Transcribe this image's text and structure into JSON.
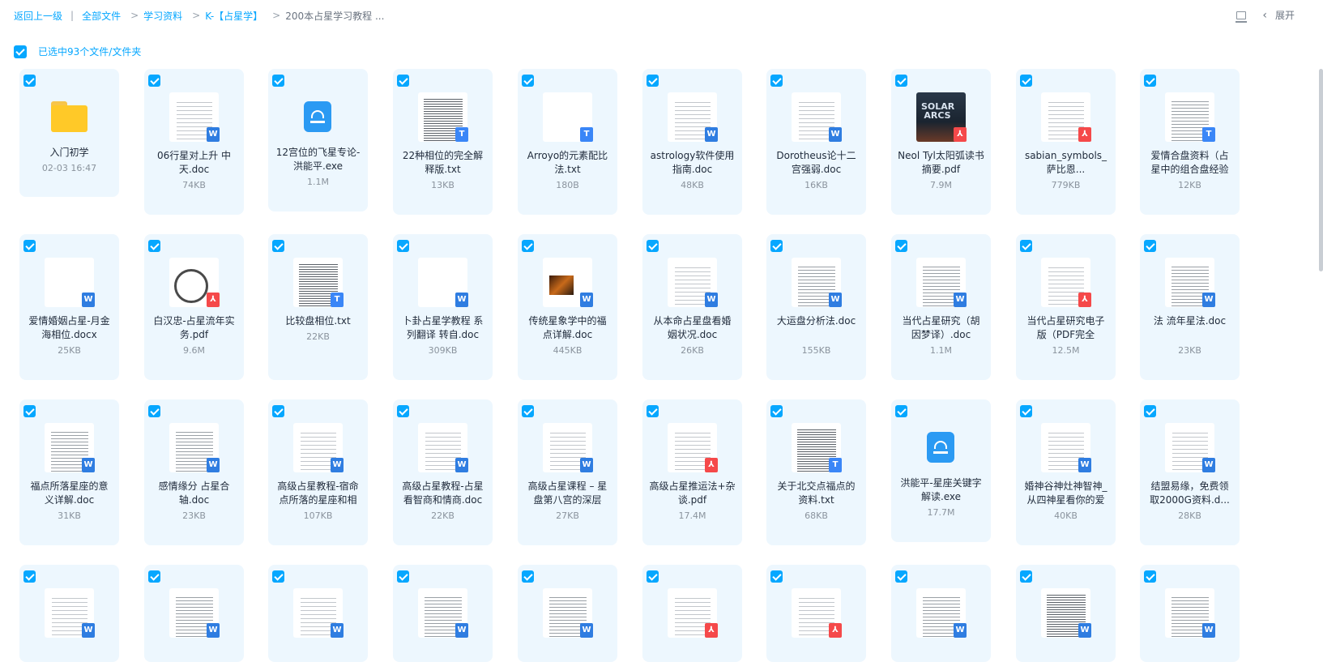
{
  "breadcrumb": {
    "back": "返回上一级",
    "all_files": "全部文件",
    "study": "学习资料",
    "astro": "K-【占星学】",
    "current": "200本占星学习教程 ..."
  },
  "topright": {
    "expand": "展开"
  },
  "selection": {
    "text": "已选中93个文件/文件夹"
  },
  "colors": {
    "accent": "#06a7ff",
    "card_bg": "#edf7fe",
    "doc_badge": "#2f7de1",
    "pdf_badge": "#f5494a"
  },
  "files": [
    {
      "name": "入门初学",
      "meta": "02-03 16:47",
      "kind": "folder",
      "thumb": "folder"
    },
    {
      "name": "06行星对上升 中天.doc",
      "meta": "74KB",
      "kind": "doc",
      "thumb": "light"
    },
    {
      "name": "12宫位的飞星专论-洪能平.exe",
      "meta": "1.1M",
      "kind": "exe",
      "thumb": "exe"
    },
    {
      "name": "22种相位的完全解释版.txt",
      "meta": "13KB",
      "kind": "txt",
      "thumb": "dense"
    },
    {
      "name": "Arroyo的元素配比法.txt",
      "meta": "180B",
      "kind": "txt",
      "thumb": "blank"
    },
    {
      "name": "astrology软件使用指南.doc",
      "meta": "48KB",
      "kind": "doc",
      "thumb": "light"
    },
    {
      "name": "Dorotheus论十二宫强弱.doc",
      "meta": "16KB",
      "kind": "doc",
      "thumb": "light"
    },
    {
      "name": "Neol Tyl太阳弧读书摘要.pdf",
      "meta": "7.9M",
      "kind": "pdf",
      "thumb": "book",
      "cover": "SOLAR ARCS"
    },
    {
      "name": "sabian_symbols_萨比恩...",
      "meta": "779KB",
      "kind": "pdf",
      "thumb": "light"
    },
    {
      "name": "爱情合盘资料（占星中的组合盘经验",
      "meta": "12KB",
      "kind": "txt",
      "thumb": "lined"
    },
    {
      "name": "爱情婚姻占星-月金海相位.docx",
      "meta": "25KB",
      "kind": "doc",
      "thumb": "blank"
    },
    {
      "name": "白汉忠-占星流年实务.pdf",
      "meta": "9.6M",
      "kind": "pdf",
      "thumb": "wheel"
    },
    {
      "name": "比较盘相位.txt",
      "meta": "22KB",
      "kind": "txt",
      "thumb": "dense"
    },
    {
      "name": "卜卦占星学教程 系列翻译 转自.doc",
      "meta": "309KB",
      "kind": "doc",
      "thumb": "blank"
    },
    {
      "name": "传统星象学中的福点详解.doc",
      "meta": "445KB",
      "kind": "doc",
      "thumb": "photo"
    },
    {
      "name": "从本命占星盘看婚姻状况.doc",
      "meta": "26KB",
      "kind": "doc",
      "thumb": "light"
    },
    {
      "name": "大运盘分析法.doc",
      "meta": "155KB",
      "kind": "doc",
      "thumb": "lined"
    },
    {
      "name": "当代占星研究（胡因梦译）.doc",
      "meta": "1.1M",
      "kind": "doc",
      "thumb": "lined"
    },
    {
      "name": "当代占星研究电子版（PDF完全",
      "meta": "12.5M",
      "kind": "pdf",
      "thumb": "light"
    },
    {
      "name": "法 流年星法.doc",
      "meta": "23KB",
      "kind": "doc",
      "thumb": "lined"
    },
    {
      "name": "福点所落星座的意义详解.doc",
      "meta": "31KB",
      "kind": "doc",
      "thumb": "lined"
    },
    {
      "name": "感情缘分 占星合轴.doc",
      "meta": "23KB",
      "kind": "doc",
      "thumb": "lined"
    },
    {
      "name": "高级占星教程-宿命点所落的星座和相",
      "meta": "107KB",
      "kind": "doc",
      "thumb": "light"
    },
    {
      "name": "高级占星教程-占星看智商和情商.doc",
      "meta": "22KB",
      "kind": "doc",
      "thumb": "light"
    },
    {
      "name": "高级占星课程 – 星盘第八宫的深层",
      "meta": "27KB",
      "kind": "doc",
      "thumb": "light"
    },
    {
      "name": "高级占星推运法+杂谈.pdf",
      "meta": "17.4M",
      "kind": "pdf",
      "thumb": "light"
    },
    {
      "name": "关于北交点福点的资料.txt",
      "meta": "68KB",
      "kind": "txt",
      "thumb": "dense"
    },
    {
      "name": "洪能平-星座关键字解读.exe",
      "meta": "17.7M",
      "kind": "exe",
      "thumb": "exe"
    },
    {
      "name": "婚神谷神灶神智神_从四神星看你的爱",
      "meta": "40KB",
      "kind": "doc",
      "thumb": "light"
    },
    {
      "name": "结盟易缘，免费领取2000G资料.d...",
      "meta": "28KB",
      "kind": "doc",
      "thumb": "light"
    },
    {
      "name": "",
      "meta": "",
      "kind": "doc",
      "thumb": "light"
    },
    {
      "name": "",
      "meta": "",
      "kind": "doc",
      "thumb": "lined"
    },
    {
      "name": "",
      "meta": "",
      "kind": "doc",
      "thumb": "light"
    },
    {
      "name": "",
      "meta": "",
      "kind": "doc",
      "thumb": "lined"
    },
    {
      "name": "",
      "meta": "",
      "kind": "doc",
      "thumb": "lined"
    },
    {
      "name": "",
      "meta": "",
      "kind": "pdf",
      "thumb": "light"
    },
    {
      "name": "",
      "meta": "",
      "kind": "pdf",
      "thumb": "light"
    },
    {
      "name": "",
      "meta": "",
      "kind": "doc",
      "thumb": "lined"
    },
    {
      "name": "",
      "meta": "",
      "kind": "doc",
      "thumb": "dense"
    },
    {
      "name": "",
      "meta": "",
      "kind": "doc",
      "thumb": "lined"
    }
  ]
}
